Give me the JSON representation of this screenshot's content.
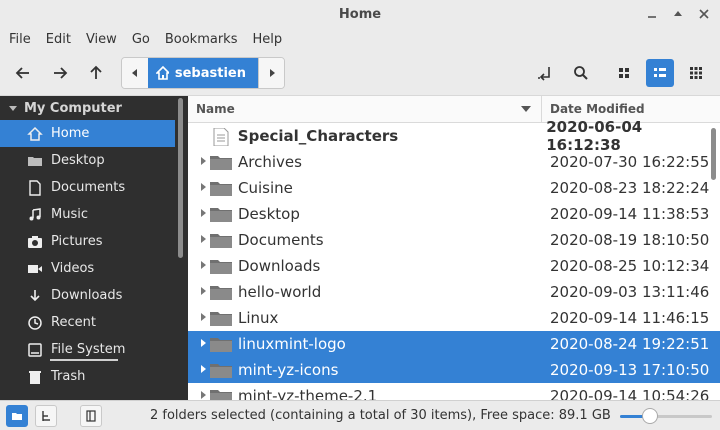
{
  "window": {
    "title": "Home"
  },
  "menu": [
    "File",
    "Edit",
    "View",
    "Go",
    "Bookmarks",
    "Help"
  ],
  "path": {
    "current": "sebastien"
  },
  "sidebar": {
    "section": "My Computer",
    "items": [
      {
        "label": "Home",
        "icon": "home-icon",
        "active": true
      },
      {
        "label": "Desktop",
        "icon": "folder-icon"
      },
      {
        "label": "Documents",
        "icon": "document-icon"
      },
      {
        "label": "Music",
        "icon": "music-icon"
      },
      {
        "label": "Pictures",
        "icon": "camera-icon"
      },
      {
        "label": "Videos",
        "icon": "video-icon"
      },
      {
        "label": "Downloads",
        "icon": "download-icon"
      },
      {
        "label": "Recent",
        "icon": "clock-icon"
      },
      {
        "label": "File System",
        "icon": "drive-icon"
      },
      {
        "label": "Trash",
        "icon": "trash-icon"
      }
    ]
  },
  "columns": {
    "name": "Name",
    "date": "Date Modified"
  },
  "files": [
    {
      "name": "Special_Characters",
      "date": "2020-06-04 16:12:38",
      "type": "file",
      "bold": true
    },
    {
      "name": "Archives",
      "date": "2020-07-30 16:22:55",
      "type": "folder"
    },
    {
      "name": "Cuisine",
      "date": "2020-08-23 18:22:24",
      "type": "folder"
    },
    {
      "name": "Desktop",
      "date": "2020-09-14 11:38:53",
      "type": "folder"
    },
    {
      "name": "Documents",
      "date": "2020-08-19 18:10:50",
      "type": "folder"
    },
    {
      "name": "Downloads",
      "date": "2020-08-25 10:12:34",
      "type": "folder"
    },
    {
      "name": "hello-world",
      "date": "2020-09-03 13:11:46",
      "type": "folder"
    },
    {
      "name": "Linux",
      "date": "2020-09-14 11:46:15",
      "type": "folder"
    },
    {
      "name": "linuxmint-logo",
      "date": "2020-08-24 19:22:51",
      "type": "folder",
      "selected": true
    },
    {
      "name": "mint-yz-icons",
      "date": "2020-09-13 17:10:50",
      "type": "folder",
      "selected": true
    },
    {
      "name": "mint-yz-theme-2.1",
      "date": "2020-09-14 10:54:26",
      "type": "folder"
    }
  ],
  "status": {
    "text": "2 folders selected (containing a total of 30 items), Free space: 89.1 GB",
    "zoom": 0.33
  },
  "colors": {
    "accent": "#3481d4",
    "sidebar_bg": "#2f2f2f"
  }
}
